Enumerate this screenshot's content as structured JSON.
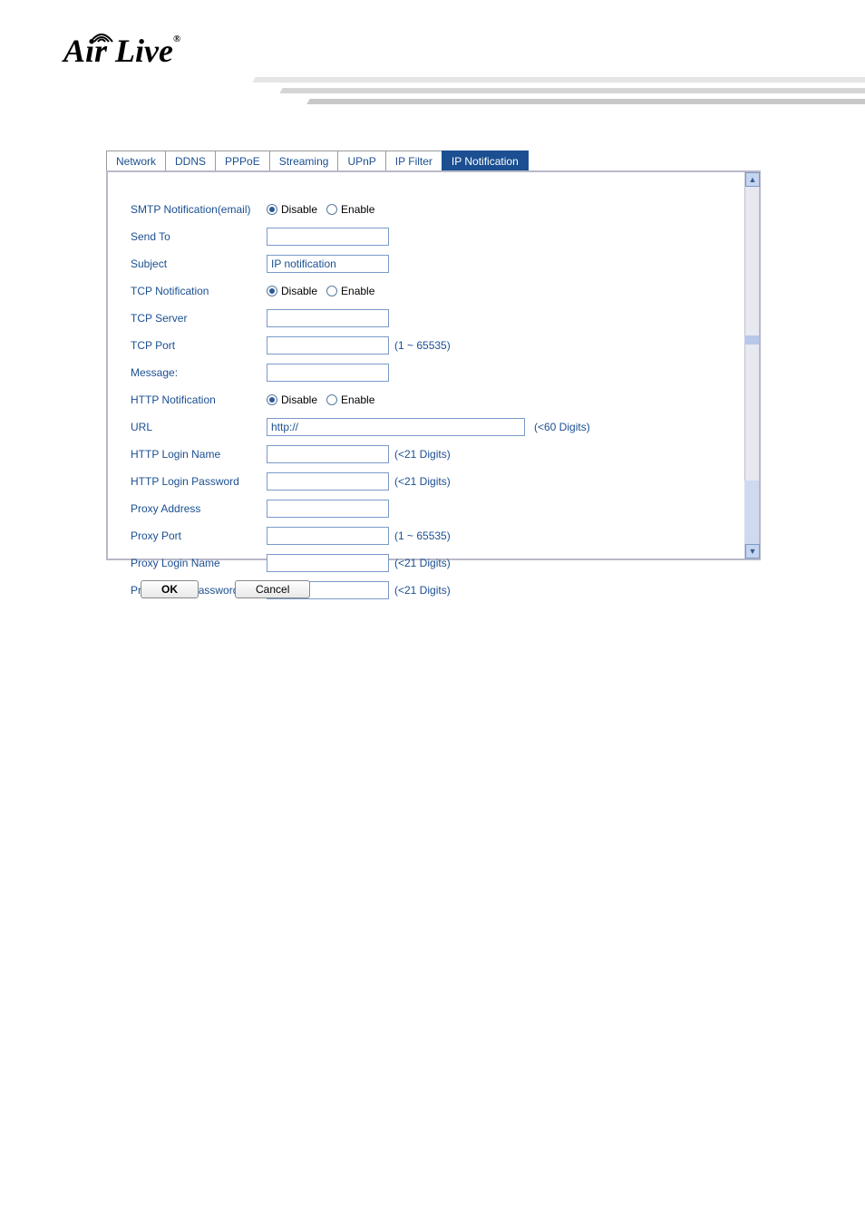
{
  "logo_text": "Air Live",
  "tabs": {
    "network": "Network",
    "ddns": "DDNS",
    "pppoe": "PPPoE",
    "streaming": "Streaming",
    "upnp": "UPnP",
    "ipfilter": "IP Filter",
    "ipnotification": "IP Notification"
  },
  "form": {
    "smtp_label": "SMTP Notification(email)",
    "sendto_label": "Send To",
    "subject_label": "Subject",
    "subject_value": "IP notification",
    "tcpnotif_label": "TCP Notification",
    "tcpserver_label": "TCP Server",
    "tcpport_label": "TCP Port",
    "port_hint": "(1 ~ 65535)",
    "message_label": "Message:",
    "httpnotif_label": "HTTP Notification",
    "url_label": "URL",
    "url_value": "http://",
    "url_hint": "(<60 Digits)",
    "httplogin_label": "HTTP Login Name",
    "digits21_hint": "(<21 Digits)",
    "httppass_label": "HTTP Login Password",
    "proxyaddr_label": "Proxy Address",
    "proxyport_label": "Proxy Port",
    "proxylogin_label": "Proxy Login Name",
    "proxypass_label": "Proxy Login Password",
    "radio_disable": "Disable",
    "radio_enable": "Enable"
  },
  "buttons": {
    "ok": "OK",
    "cancel": "Cancel"
  }
}
